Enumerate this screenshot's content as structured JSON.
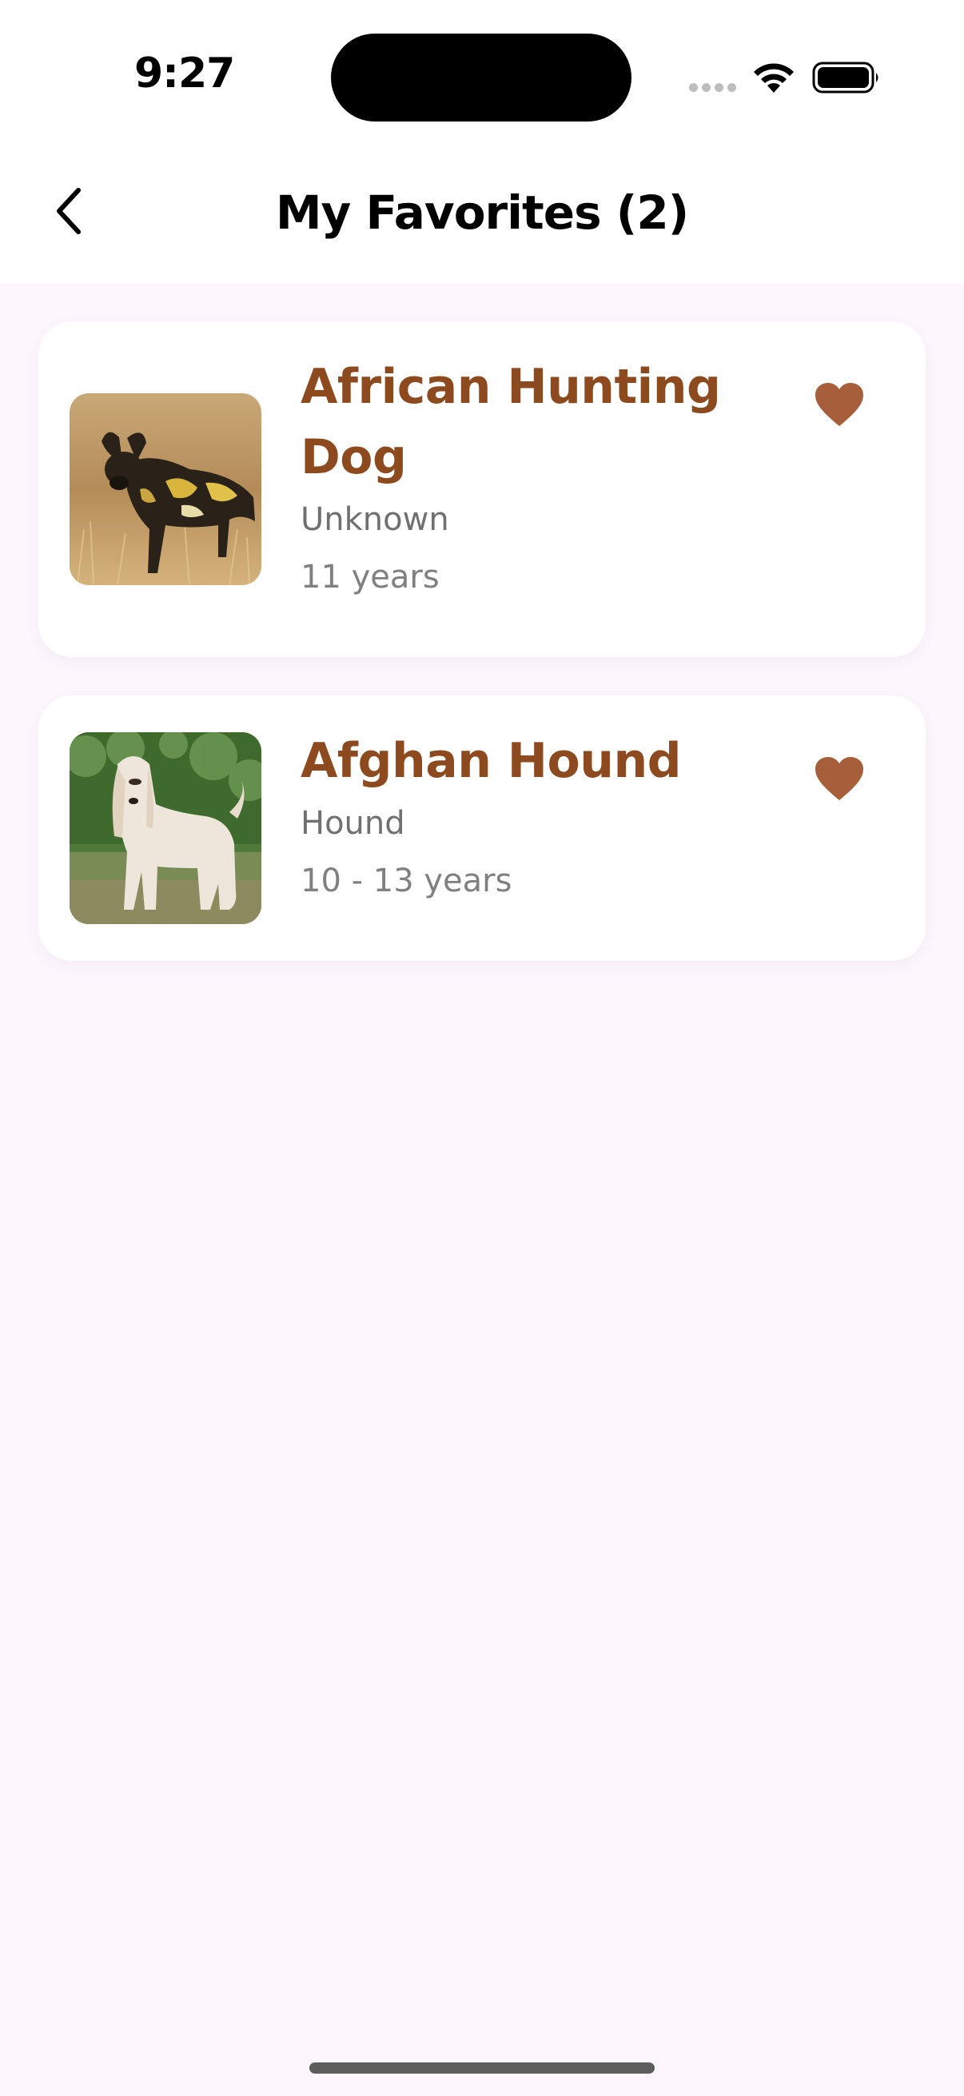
{
  "status_bar": {
    "time": "9:27",
    "icons": [
      "cellular-signal-icon",
      "wifi-icon",
      "battery-icon"
    ]
  },
  "nav": {
    "back_icon": "chevron-left-icon",
    "title": "My Favorites (2)"
  },
  "favorites": [
    {
      "name": "African Hunting Dog",
      "group": "Unknown",
      "life_span": "11 years",
      "image": "african-hunting-dog-photo",
      "favorited": true
    },
    {
      "name": "Afghan Hound",
      "group": "Hound",
      "life_span": "10 - 13 years",
      "image": "afghan-hound-photo",
      "favorited": true
    }
  ],
  "colors": {
    "accent": "#8c4a1e",
    "heart": "#a65f3a",
    "background": "#fdf6fd",
    "card": "#ffffff"
  }
}
